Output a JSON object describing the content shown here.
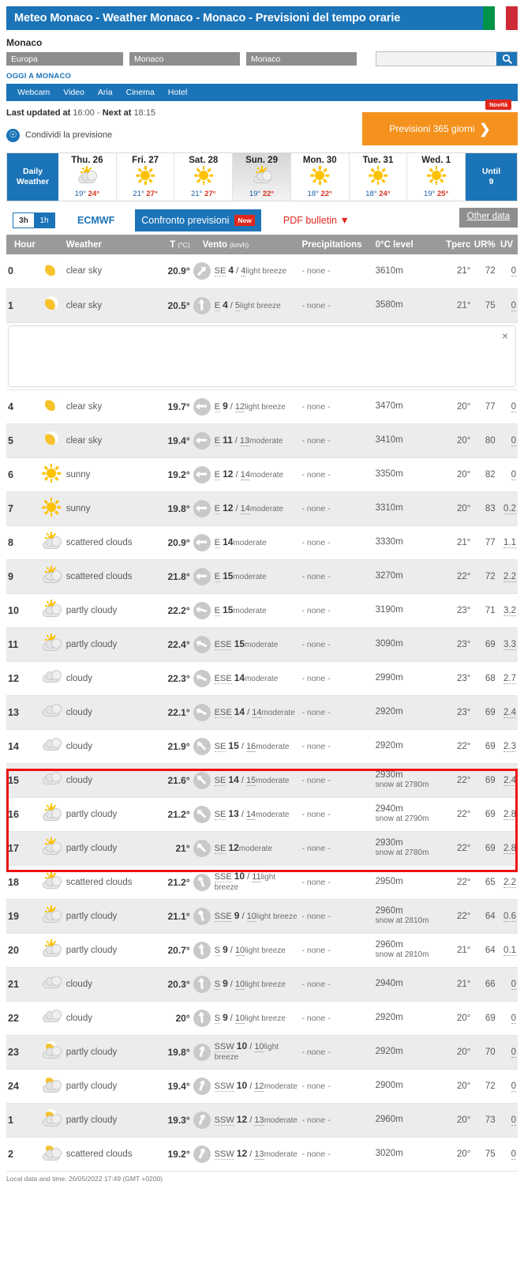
{
  "titlebar": {
    "title": "Meteo Monaco - Weather Monaco - Monaco - Previsioni del tempo orarie",
    "flag": "italy-flag"
  },
  "location": {
    "name": "Monaco",
    "selects": {
      "continent": "Europa",
      "country": "Monaco",
      "city": "Monaco"
    },
    "search_placeholder": "",
    "search_value": "",
    "search_icon": "search-icon"
  },
  "today_label": "OGGI A MONACO",
  "nav": {
    "items": [
      "Webcam",
      "Video",
      "Aria",
      "Cinema",
      "Hotel"
    ]
  },
  "status": {
    "last_updated_label": "Last updated at",
    "last_updated_time": "16:00",
    "next_label": "Next at",
    "next_time": "18:15",
    "share_label": "Condividi la previsione",
    "btn365_label": "Previsioni 365 giorni",
    "btn365_badge": "Novità"
  },
  "daystrip": {
    "first_label": "Daily\nWeather",
    "first_label_line1": "Daily",
    "first_label_line2": "Weather",
    "last_label_line1": "Until",
    "last_label_line2": "9",
    "days": [
      {
        "name": "Thu. 26",
        "icon": "sun-cloud-icon",
        "low": "19°",
        "high": "24°",
        "selected": false
      },
      {
        "name": "Fri. 27",
        "icon": "sun-icon",
        "low": "21°",
        "high": "27°",
        "selected": false
      },
      {
        "name": "Sat. 28",
        "icon": "sun-icon",
        "low": "21°",
        "high": "27°",
        "selected": false
      },
      {
        "name": "Sun. 29",
        "icon": "sun-cloud-icon",
        "low": "19°",
        "high": "22°",
        "selected": true
      },
      {
        "name": "Mon. 30",
        "icon": "sun-icon",
        "low": "18°",
        "high": "22°",
        "selected": false
      },
      {
        "name": "Tue. 31",
        "icon": "sun-icon",
        "low": "18°",
        "high": "24°",
        "selected": false
      },
      {
        "name": "Wed. 1",
        "icon": "sun-icon",
        "low": "19°",
        "high": "25°",
        "selected": false
      }
    ]
  },
  "tools": {
    "switch_3h": "3h",
    "switch_1h": "1h",
    "model": "ECMWF",
    "compare": "Confronto previsioni",
    "compare_badge": "New",
    "pdf": "PDF bulletin",
    "pdf_caret": "▼",
    "other_data": "Other data"
  },
  "table": {
    "headers": {
      "hour": "Hour",
      "weather": "Weather",
      "temp": "T",
      "temp_unit": "(°C)",
      "wind": "Vento",
      "wind_unit": "(km/h)",
      "precipitations": "Precipitations",
      "zero_level": "0°C level",
      "tperc": "Tperc",
      "ur": "UR%",
      "uv": "UV"
    },
    "ad_close_icon": "close-icon",
    "rows": [
      {
        "hour": "0",
        "icon": "moon-icon",
        "desc": "clear sky",
        "temp": "20.9°",
        "wind_dir": "SE",
        "wind_speed": "4",
        "wind_gust": "4",
        "wind_desc": "light breeze",
        "wind_rot": 315,
        "prec": "- none -",
        "zero": "3610m",
        "snow": "",
        "tperc": "21°",
        "ur": "72",
        "uv": "0"
      },
      {
        "hour": "1",
        "icon": "moon-icon",
        "desc": "clear sky",
        "temp": "20.5°",
        "wind_dir": "E",
        "wind_speed": "4",
        "wind_gust": "5",
        "wind_desc": "light breeze",
        "wind_rot": 270,
        "prec": "- none -",
        "zero": "3580m",
        "snow": "",
        "tperc": "21°",
        "ur": "75",
        "uv": "0"
      },
      {
        "hour": "4",
        "icon": "moon-icon",
        "desc": "clear sky",
        "temp": "19.7°",
        "wind_dir": "E",
        "wind_speed": "9",
        "wind_gust": "12",
        "wind_desc": "light breeze",
        "wind_rot": 180,
        "prec": "- none -",
        "zero": "3470m",
        "snow": "",
        "tperc": "20°",
        "ur": "77",
        "uv": "0"
      },
      {
        "hour": "5",
        "icon": "moon-icon",
        "desc": "clear sky",
        "temp": "19.4°",
        "wind_dir": "E",
        "wind_speed": "11",
        "wind_gust": "13",
        "wind_desc": "moderate",
        "wind_rot": 180,
        "prec": "- none -",
        "zero": "3410m",
        "snow": "",
        "tperc": "20°",
        "ur": "80",
        "uv": "0"
      },
      {
        "hour": "6",
        "icon": "sun-icon",
        "desc": "sunny",
        "temp": "19.2°",
        "wind_dir": "E",
        "wind_speed": "12",
        "wind_gust": "14",
        "wind_desc": "moderate",
        "wind_rot": 180,
        "prec": "- none -",
        "zero": "3350m",
        "snow": "",
        "tperc": "20°",
        "ur": "82",
        "uv": "0"
      },
      {
        "hour": "7",
        "icon": "sun-icon",
        "desc": "sunny",
        "temp": "19.8°",
        "wind_dir": "E",
        "wind_speed": "12",
        "wind_gust": "14",
        "wind_desc": "moderate",
        "wind_rot": 180,
        "prec": "- none -",
        "zero": "3310m",
        "snow": "",
        "tperc": "20°",
        "ur": "83",
        "uv": "0.2"
      },
      {
        "hour": "8",
        "icon": "sun-cloud-icon",
        "desc": "scattered clouds",
        "temp": "20.9°",
        "wind_dir": "E",
        "wind_speed": "14",
        "wind_gust": "",
        "wind_desc": "moderate",
        "wind_rot": 180,
        "prec": "- none -",
        "zero": "3330m",
        "snow": "",
        "tperc": "21°",
        "ur": "77",
        "uv": "1.1"
      },
      {
        "hour": "9",
        "icon": "sun-cloud-icon",
        "desc": "scattered clouds",
        "temp": "21.8°",
        "wind_dir": "E",
        "wind_speed": "15",
        "wind_gust": "",
        "wind_desc": "moderate",
        "wind_rot": 180,
        "prec": "- none -",
        "zero": "3270m",
        "snow": "",
        "tperc": "22°",
        "ur": "72",
        "uv": "2.2"
      },
      {
        "hour": "10",
        "icon": "sun-cloud-icon",
        "desc": "partly cloudy",
        "temp": "22.2°",
        "wind_dir": "E",
        "wind_speed": "15",
        "wind_gust": "",
        "wind_desc": "moderate",
        "wind_rot": 195,
        "prec": "- none -",
        "zero": "3190m",
        "snow": "",
        "tperc": "23°",
        "ur": "71",
        "uv": "3.2"
      },
      {
        "hour": "11",
        "icon": "sun-cloud-icon",
        "desc": "partly cloudy",
        "temp": "22.4°",
        "wind_dir": "ESE",
        "wind_speed": "15",
        "wind_gust": "",
        "wind_desc": "moderate",
        "wind_rot": 205,
        "prec": "- none -",
        "zero": "3090m",
        "snow": "",
        "tperc": "23°",
        "ur": "69",
        "uv": "3.3"
      },
      {
        "hour": "12",
        "icon": "cloud-icon",
        "desc": "cloudy",
        "temp": "22.3°",
        "wind_dir": "ESE",
        "wind_speed": "14",
        "wind_gust": "",
        "wind_desc": "moderate",
        "wind_rot": 205,
        "prec": "- none -",
        "zero": "2990m",
        "snow": "",
        "tperc": "23°",
        "ur": "68",
        "uv": "2.7"
      },
      {
        "hour": "13",
        "icon": "cloud-icon",
        "desc": "cloudy",
        "temp": "22.1°",
        "wind_dir": "ESE",
        "wind_speed": "14",
        "wind_gust": "14",
        "wind_desc": "moderate",
        "wind_rot": 205,
        "prec": "- none -",
        "zero": "2920m",
        "snow": "",
        "tperc": "23°",
        "ur": "69",
        "uv": "2.4"
      },
      {
        "hour": "14",
        "icon": "cloud-icon",
        "desc": "cloudy",
        "temp": "21.9°",
        "wind_dir": "SE",
        "wind_speed": "15",
        "wind_gust": "16",
        "wind_desc": "moderate",
        "wind_rot": 225,
        "prec": "- none -",
        "zero": "2920m",
        "snow": "",
        "tperc": "22°",
        "ur": "69",
        "uv": "2.3"
      },
      {
        "hour": "15",
        "icon": "cloud-icon",
        "desc": "cloudy",
        "temp": "21.6°",
        "wind_dir": "SE",
        "wind_speed": "14",
        "wind_gust": "15",
        "wind_desc": "moderate",
        "wind_rot": 225,
        "prec": "- none -",
        "zero": "2930m",
        "snow": "snow at 2780m",
        "tperc": "22°",
        "ur": "69",
        "uv": "2.4",
        "highlight": true
      },
      {
        "hour": "16",
        "icon": "sun-cloud-icon",
        "desc": "partly cloudy",
        "temp": "21.2°",
        "wind_dir": "SE",
        "wind_speed": "13",
        "wind_gust": "14",
        "wind_desc": "moderate",
        "wind_rot": 225,
        "prec": "- none -",
        "zero": "2940m",
        "snow": "snow at 2790m",
        "tperc": "22°",
        "ur": "69",
        "uv": "2.8",
        "highlight": true
      },
      {
        "hour": "17",
        "icon": "sun-cloud-icon",
        "desc": "partly cloudy",
        "temp": "21°",
        "wind_dir": "SE",
        "wind_speed": "12",
        "wind_gust": "",
        "wind_desc": "moderate",
        "wind_rot": 225,
        "prec": "- none -",
        "zero": "2930m",
        "snow": "snow at 2780m",
        "tperc": "22°",
        "ur": "69",
        "uv": "2.8",
        "highlight": true
      },
      {
        "hour": "18",
        "icon": "sun-cloud-icon",
        "desc": "scattered clouds",
        "temp": "21.2°",
        "wind_dir": "SSE",
        "wind_speed": "10",
        "wind_gust": "11",
        "wind_desc": "light breeze",
        "wind_rot": 250,
        "prec": "- none -",
        "zero": "2950m",
        "snow": "",
        "tperc": "22°",
        "ur": "65",
        "uv": "2.2"
      },
      {
        "hour": "19",
        "icon": "sun-cloud-icon",
        "desc": "partly cloudy",
        "temp": "21.1°",
        "wind_dir": "SSE",
        "wind_speed": "9",
        "wind_gust": "10",
        "wind_desc": "light breeze",
        "wind_rot": 255,
        "prec": "- none -",
        "zero": "2960m",
        "snow": "snow at 2810m",
        "tperc": "22°",
        "ur": "64",
        "uv": "0.6"
      },
      {
        "hour": "20",
        "icon": "sun-cloud-icon",
        "desc": "partly cloudy",
        "temp": "20.7°",
        "wind_dir": "S",
        "wind_speed": "9",
        "wind_gust": "10",
        "wind_desc": "light breeze",
        "wind_rot": 265,
        "prec": "- none -",
        "zero": "2960m",
        "snow": "snow at 2810m",
        "tperc": "21°",
        "ur": "64",
        "uv": "0.1"
      },
      {
        "hour": "21",
        "icon": "cloud-icon",
        "desc": "cloudy",
        "temp": "20.3°",
        "wind_dir": "S",
        "wind_speed": "9",
        "wind_gust": "10",
        "wind_desc": "light breeze",
        "wind_rot": 265,
        "prec": "- none -",
        "zero": "2940m",
        "snow": "",
        "tperc": "21°",
        "ur": "66",
        "uv": "0"
      },
      {
        "hour": "22",
        "icon": "cloud-icon",
        "desc": "cloudy",
        "temp": "20°",
        "wind_dir": "S",
        "wind_speed": "9",
        "wind_gust": "10",
        "wind_desc": "light breeze",
        "wind_rot": 265,
        "prec": "- none -",
        "zero": "2920m",
        "snow": "",
        "tperc": "20°",
        "ur": "69",
        "uv": "0"
      },
      {
        "hour": "23",
        "icon": "moon-cloud-icon",
        "desc": "partly cloudy",
        "temp": "19.8°",
        "wind_dir": "SSW",
        "wind_speed": "10",
        "wind_gust": "10",
        "wind_desc": "light breeze",
        "wind_rot": 285,
        "prec": "- none -",
        "zero": "2920m",
        "snow": "",
        "tperc": "20°",
        "ur": "70",
        "uv": "0"
      },
      {
        "hour": "24",
        "icon": "moon-cloud-icon",
        "desc": "partly cloudy",
        "temp": "19.4°",
        "wind_dir": "SSW",
        "wind_speed": "10",
        "wind_gust": "12",
        "wind_desc": "moderate",
        "wind_rot": 290,
        "prec": "- none -",
        "zero": "2900m",
        "snow": "",
        "tperc": "20°",
        "ur": "72",
        "uv": "0"
      },
      {
        "hour": "1",
        "icon": "moon-cloud-icon",
        "desc": "partly cloudy",
        "temp": "19.3°",
        "wind_dir": "SSW",
        "wind_speed": "12",
        "wind_gust": "13",
        "wind_desc": "moderate",
        "wind_rot": 295,
        "prec": "- none -",
        "zero": "2960m",
        "snow": "",
        "tperc": "20°",
        "ur": "73",
        "uv": "0"
      },
      {
        "hour": "2",
        "icon": "moon-cloud-icon",
        "desc": "scattered clouds",
        "temp": "19.2°",
        "wind_dir": "SSW",
        "wind_speed": "12",
        "wind_gust": "13",
        "wind_desc": "moderate",
        "wind_rot": 295,
        "prec": "- none -",
        "zero": "3020m",
        "snow": "",
        "tperc": "20°",
        "ur": "75",
        "uv": "0"
      }
    ]
  },
  "footer": "Local data and time: 26/05/2022 17:49 (GMT +0200)",
  "colors": {
    "brand_blue": "#1b74b8",
    "orange": "#f5921e",
    "red": "#e1261c",
    "highlight_red": "#ee1111",
    "header_grey": "#9a9a9a"
  }
}
